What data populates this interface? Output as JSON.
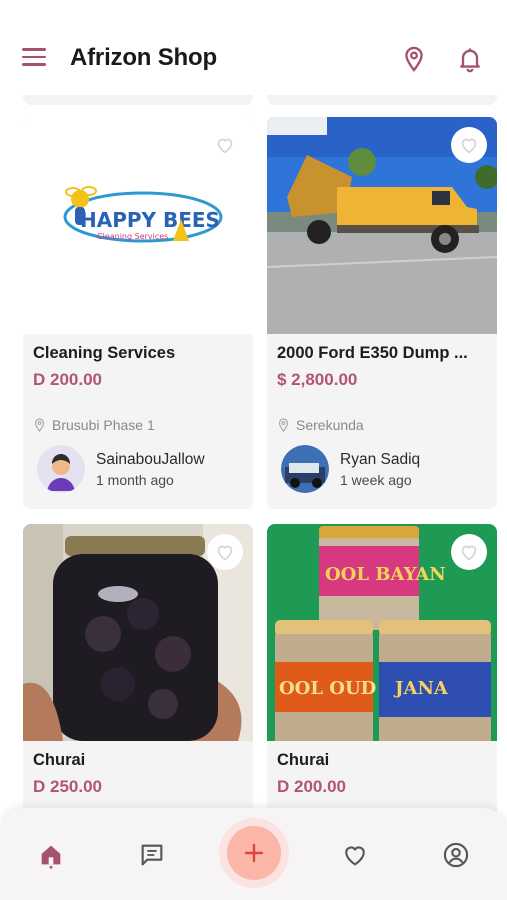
{
  "app": {
    "title": "Afrizon Shop",
    "accent": "#b2566f"
  },
  "appbar": {
    "menu_icon": "menu-icon",
    "location_icon": "location-pin-icon",
    "notification_icon": "bell-icon"
  },
  "listings": [
    {
      "title": "Cleaning Services",
      "price": "D 200.00",
      "location": "Brusubi Phase 1",
      "seller": "SainabouJallow",
      "posted": "1 month ago",
      "image": "happy-bees-logo",
      "logo_text": "HAPPY BEES",
      "logo_subtext": "Cleaning Services"
    },
    {
      "title": "2000 Ford E350 Dump ...",
      "price": "$ 2,800.00",
      "location": "Serekunda",
      "seller": "Ryan Sadiq",
      "posted": "1 week ago",
      "image": "yellow-dump-truck-photo"
    },
    {
      "title": "Churai",
      "price": "D 250.00",
      "image": "jar-of-churai-photo"
    },
    {
      "title": "Churai",
      "price": "D 200.00",
      "image": "churai-jars-photo",
      "jar_labels": [
        "OOL BAYAN",
        "OOL OUD",
        "JANA"
      ]
    }
  ],
  "bottom_nav": {
    "items": [
      "home-icon",
      "chat-icon",
      "add-icon",
      "heart-icon",
      "profile-icon"
    ],
    "active": "home-icon"
  }
}
